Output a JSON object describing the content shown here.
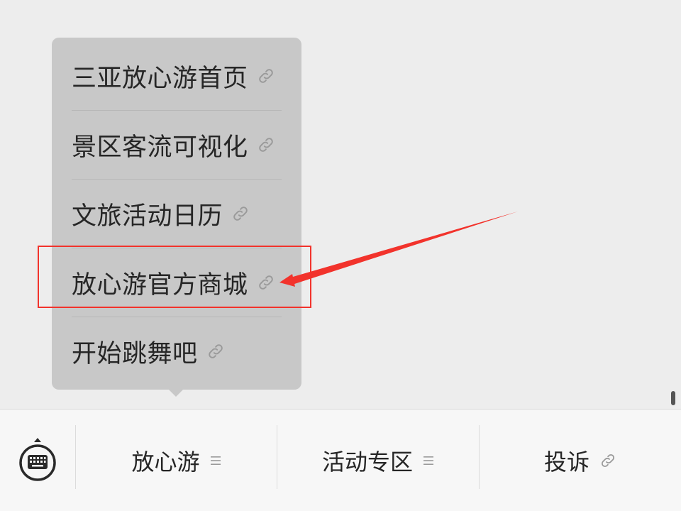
{
  "popup_menu": {
    "items": [
      {
        "label": "三亚放心游首页",
        "icon": "link-icon"
      },
      {
        "label": "景区客流可视化",
        "icon": "link-icon"
      },
      {
        "label": "文旅活动日历",
        "icon": "link-icon"
      },
      {
        "label": "放心游官方商城",
        "icon": "link-icon"
      },
      {
        "label": "开始跳舞吧",
        "icon": "link-icon"
      }
    ],
    "highlighted_index": 3
  },
  "bottom_bar": {
    "keyboard_icon": "keyboard-icon",
    "tabs": [
      {
        "label": "放心游",
        "icon": "menu-lines-icon"
      },
      {
        "label": "活动专区",
        "icon": "menu-lines-icon"
      },
      {
        "label": "投诉",
        "icon": "link-icon"
      }
    ]
  },
  "colors": {
    "highlight": "#f2332c",
    "popup_bg": "#c8c8c8",
    "page_bg": "#ededed",
    "bar_bg": "#f7f7f7"
  }
}
